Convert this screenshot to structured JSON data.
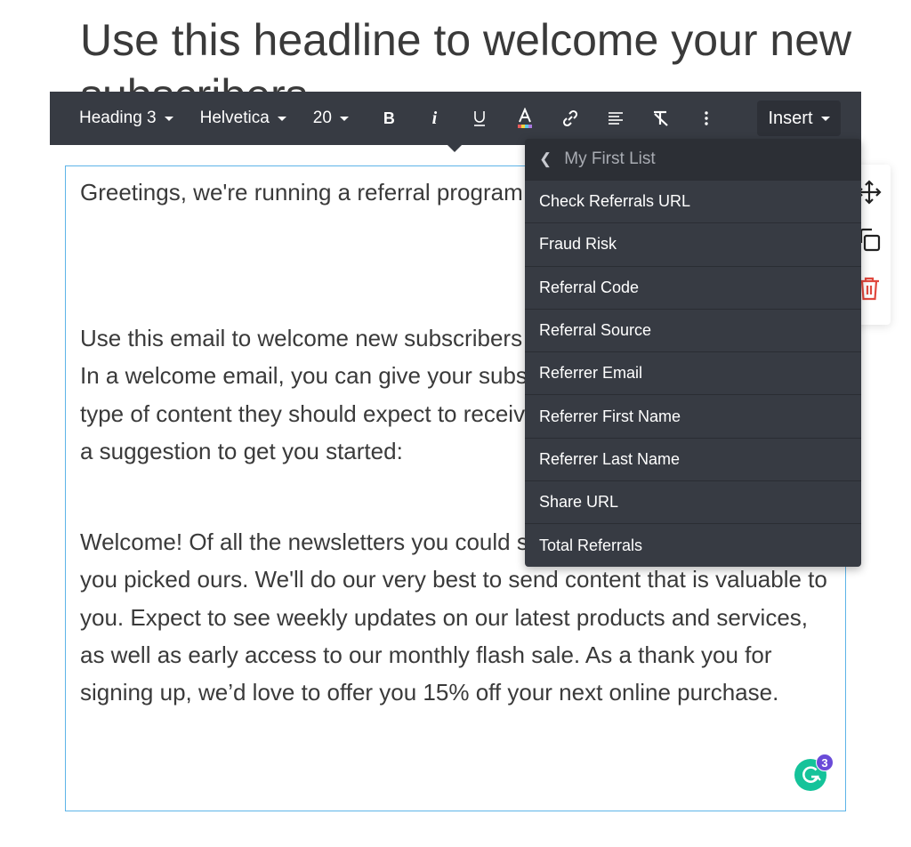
{
  "headline": "Use this headline to welcome your new subscribers",
  "toolbar": {
    "block_format": "Heading 3",
    "font_family": "Helvetica",
    "font_size": "20",
    "bold_label": "B",
    "italic_label": "i",
    "insert_label": "Insert"
  },
  "editor": {
    "paragraphs": [
      "Greetings, we're running a referral program. Share your referral code:",
      "Use this email to welcome new subscribers and send targeted messages. In a welcome email, you can give your subscribers an indication of the type of content they should expect to receive from you and more. Here's a suggestion to get you started:",
      "Welcome! Of all the newsletters you could subscribe to, we're delighted you picked ours. We'll do our very best to send content that is valuable to you. Expect to see weekly updates on our latest products and services, as well as early access to our monthly flash sale. As a thank you for signing up, we’d love to offer you 15% off your next online purchase."
    ]
  },
  "insert_menu": {
    "back_label": "My First List",
    "items": [
      "Check Referrals URL",
      "Fraud Risk",
      "Referral Code",
      "Referral Source",
      "Referrer Email",
      "Referrer First Name",
      "Referrer Last Name",
      "Share URL",
      "Total Referrals"
    ]
  },
  "grammarly": {
    "count": "3"
  },
  "colors": {
    "toolbar_bg": "#373b43",
    "editor_border": "#5db4e8",
    "delete_red": "#e0483e",
    "grammarly_green": "#15c39a",
    "grammarly_badge": "#6a4bd8"
  }
}
